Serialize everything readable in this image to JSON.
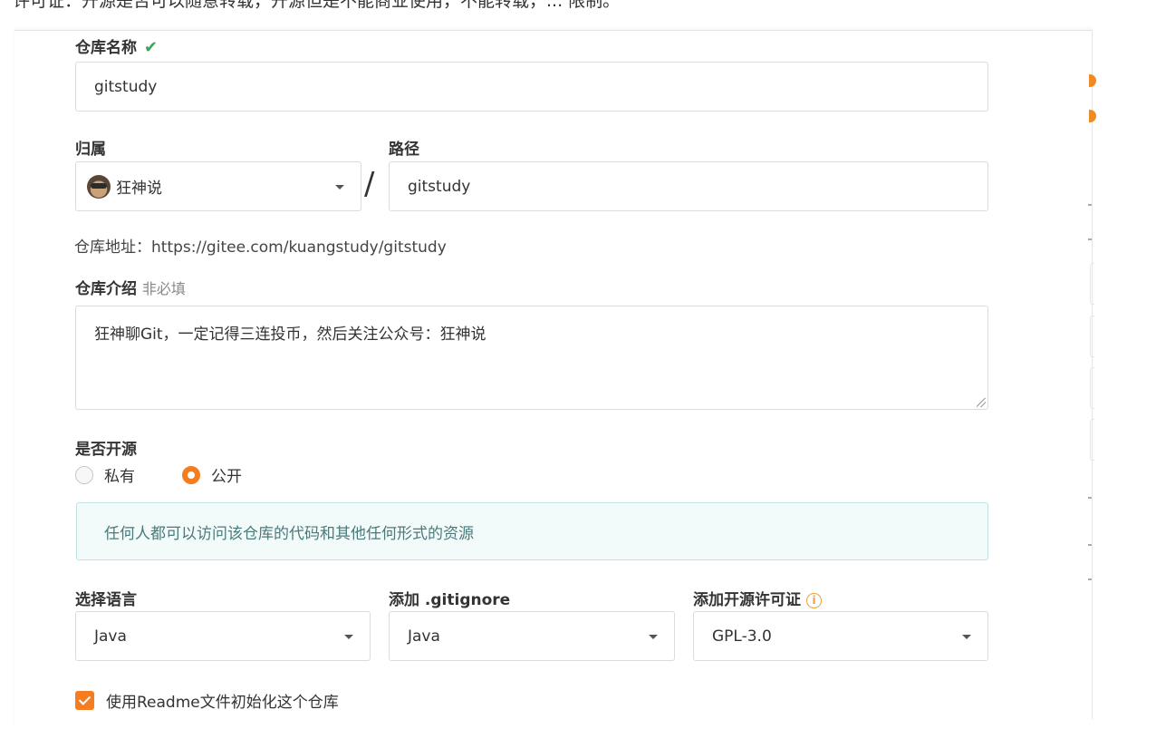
{
  "top_text": "许可证：开源是否可以随意转载，开源但是不能商业使用，不能转载，... 限制。",
  "form": {
    "repo_name_label": "仓库名称",
    "repo_name_value": "gitstudy",
    "owner_label": "归属",
    "owner_value": "狂神说",
    "path_label": "路径",
    "path_value": "gitstudy",
    "slash": "/",
    "repo_address": "仓库地址：https://gitee.com/kuangstudy/gitstudy",
    "intro_label": "仓库介绍",
    "intro_optional": "非必填",
    "intro_value": "狂神聊Git，一定记得三连投币，然后关注公众号：狂神说",
    "visibility_label": "是否开源",
    "visibility_options": [
      "私有",
      "公开"
    ],
    "visibility_selected": "公开",
    "visibility_notice": "任何人都可以访问该仓库的代码和其他任何形式的资源",
    "language_label": "选择语言",
    "language_value": "Java",
    "gitignore_label": "添加 .gitignore",
    "gitignore_value": "Java",
    "license_label": "添加开源许可证",
    "license_value": "GPL-3.0",
    "readme_label": "使用Readme文件初始化这个仓库",
    "readme_checked": true
  },
  "colors": {
    "accent": "#f57c1f",
    "valid": "#3aa757",
    "notice_bg": "#f2fafa",
    "notice_text": "#4a7a7a"
  }
}
